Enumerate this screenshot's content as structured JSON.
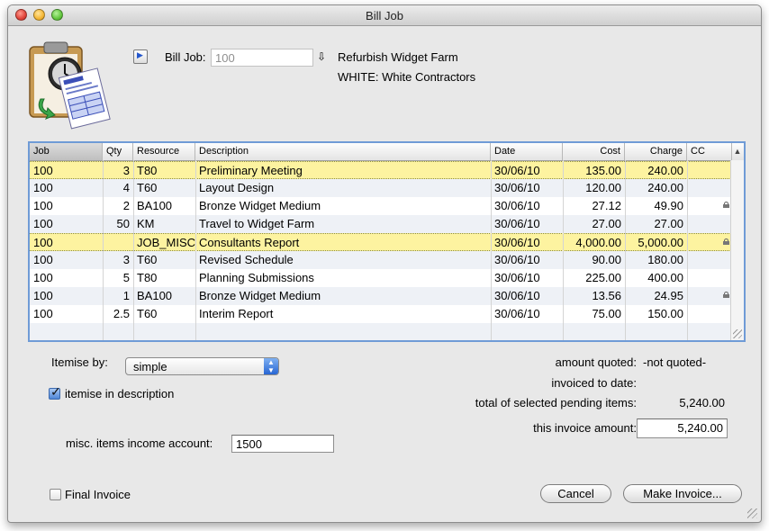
{
  "window": {
    "title": "Bill Job"
  },
  "header": {
    "disclosure_icon": "triangle-right-icon",
    "bill_job_label": "Bill Job:",
    "bill_job_value": "100",
    "lookup_icon": "arrow-down-icon",
    "job_name": "Refurbish Widget Farm",
    "client": "WHITE: White Contractors",
    "app_icon": "bill-job-clipboard-invoice-icon"
  },
  "table": {
    "columns": [
      "Job",
      "Qty",
      "Resource",
      "Description",
      "Date",
      "Cost",
      "Charge",
      "CC"
    ],
    "rows": [
      {
        "job": "100",
        "qty": "3",
        "resource": "T80",
        "description": "Preliminary Meeting",
        "date": "30/06/10",
        "cost": "135.00",
        "charge": "240.00",
        "cc": "",
        "locked": false,
        "selected": true
      },
      {
        "job": "100",
        "qty": "4",
        "resource": "T60",
        "description": "Layout Design",
        "date": "30/06/10",
        "cost": "120.00",
        "charge": "240.00",
        "cc": "",
        "locked": false,
        "selected": false
      },
      {
        "job": "100",
        "qty": "2",
        "resource": "BA100",
        "description": "Bronze Widget Medium",
        "date": "30/06/10",
        "cost": "27.12",
        "charge": "49.90",
        "cc": "",
        "locked": true,
        "selected": false
      },
      {
        "job": "100",
        "qty": "50",
        "resource": "KM",
        "description": "Travel to Widget Farm",
        "date": "30/06/10",
        "cost": "27.00",
        "charge": "27.00",
        "cc": "",
        "locked": false,
        "selected": false
      },
      {
        "job": "100",
        "qty": "",
        "resource": "JOB_MISC",
        "description": "Consultants Report",
        "date": "30/06/10",
        "cost": "4,000.00",
        "charge": "5,000.00",
        "cc": "",
        "locked": true,
        "selected": true
      },
      {
        "job": "100",
        "qty": "3",
        "resource": "T60",
        "description": "Revised Schedule",
        "date": "30/06/10",
        "cost": "90.00",
        "charge": "180.00",
        "cc": "",
        "locked": false,
        "selected": false
      },
      {
        "job": "100",
        "qty": "5",
        "resource": "T80",
        "description": "Planning Submissions",
        "date": "30/06/10",
        "cost": "225.00",
        "charge": "400.00",
        "cc": "",
        "locked": false,
        "selected": false
      },
      {
        "job": "100",
        "qty": "1",
        "resource": "BA100",
        "description": "Bronze Widget Medium",
        "date": "30/06/10",
        "cost": "13.56",
        "charge": "24.95",
        "cc": "",
        "locked": true,
        "selected": false
      },
      {
        "job": "100",
        "qty": "2.5",
        "resource": "T60",
        "description": "Interim Report",
        "date": "30/06/10",
        "cost": "75.00",
        "charge": "150.00",
        "cc": "",
        "locked": false,
        "selected": false
      }
    ],
    "sort_icon": "sort-ascending-icon",
    "selected_color": "#fdf3a0",
    "accent_color": "#6f9bd6"
  },
  "options": {
    "itemise_label": "Itemise by:",
    "itemise_value": "simple",
    "itemise_in_description_label": "itemise in description",
    "itemise_in_description_checked": true,
    "misc_account_label": "misc. items income account:",
    "misc_account_value": "1500",
    "final_invoice_label": "Final Invoice",
    "final_invoice_checked": false
  },
  "summary": {
    "amount_quoted_label": "amount quoted:",
    "amount_quoted_value": "-not quoted-",
    "invoiced_to_date_label": "invoiced to date:",
    "invoiced_to_date_value": "",
    "pending_total_label": "total of selected pending items:",
    "pending_total_value": "5,240.00",
    "invoice_amount_label": "this invoice amount:",
    "invoice_amount_value": "5,240.00"
  },
  "buttons": {
    "cancel": "Cancel",
    "make_invoice": "Make Invoice..."
  }
}
